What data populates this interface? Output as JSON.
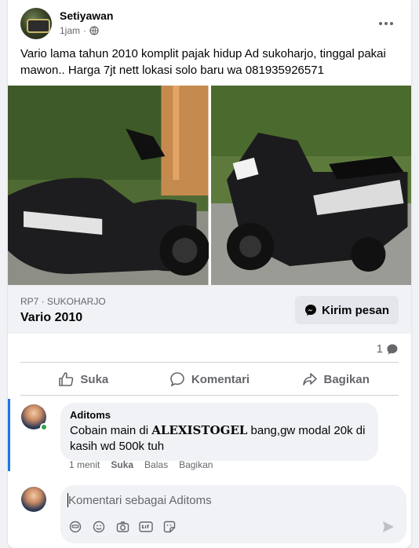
{
  "post": {
    "author": "Setiyawan",
    "time": "1jam",
    "separator": "·",
    "text": "Vario lama tahun 2010 komplit pajak hidup Ad sukoharjo, tinggal pakai mawon.. Harga 7jt nett lokasi solo baru wa 081935926571"
  },
  "listing": {
    "subtitle": "RP7 · SUKOHARJO",
    "title": "Vario 2010",
    "message_button": "Kirim pesan"
  },
  "stats": {
    "comment_count": "1"
  },
  "actions": {
    "like": "Suka",
    "comment": "Komentari",
    "share": "Bagikan"
  },
  "comment": {
    "author": "Aditoms",
    "text_before": "Cobain main di ",
    "text_bold": "ALEXISTOGEL",
    "text_after": " bang,gw modal 20k di kasih wd 500k tuh",
    "time": "1 menit",
    "like": "Suka",
    "reply": "Balas",
    "share": "Bagikan"
  },
  "compose": {
    "placeholder": "Komentari sebagai Aditoms"
  },
  "colors": {
    "accent": "#1877f2",
    "online": "#31a24c",
    "muted": "#65676b"
  },
  "icons": [
    "globe-icon",
    "more-icon",
    "messenger-icon",
    "comment-bubble-icon",
    "like-icon",
    "comment-icon",
    "share-icon",
    "avatar-icon",
    "emoji-icon",
    "camera-icon",
    "gif-icon",
    "sticker-icon",
    "send-icon"
  ]
}
